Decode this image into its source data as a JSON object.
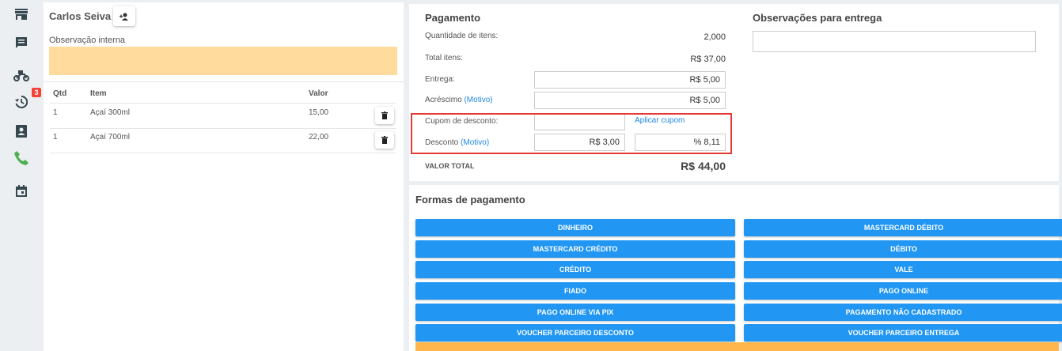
{
  "sidebar": {
    "icons": [
      "store-icon",
      "chat-icon",
      "delivery-moto-icon",
      "history-icon",
      "contact-card-icon",
      "phone-icon",
      "calendar-icon"
    ],
    "history_badge": "3",
    "phone_color": "#4caf50",
    "icon_color": "#37474f"
  },
  "order": {
    "customer_name": "Carlos Seiva",
    "internal_note_label": "Observação interna",
    "internal_note_value": "",
    "columns": {
      "qty": "Qtd",
      "item": "Item",
      "value": "Valor"
    },
    "items": [
      {
        "qty": "1",
        "name": "Açaí 300ml",
        "value": "15,00"
      },
      {
        "qty": "1",
        "name": "Açaí 700ml",
        "value": "22,00"
      }
    ]
  },
  "payment": {
    "title": "Pagamento",
    "quantity_label": "Quantidade de itens:",
    "quantity_value": "2,000",
    "total_items_label": "Total itens:",
    "total_items_value": "R$ 37,00",
    "delivery_label": "Entrega:",
    "delivery_value": "R$ 5,00",
    "surcharge_label": "Acréscimo",
    "motivo": "(Motivo)",
    "surcharge_value": "R$ 5,00",
    "coupon_label": "Cupom de desconto:",
    "coupon_value": "",
    "apply_coupon": "Aplicar cupom",
    "discount_label": "Desconto",
    "discount_value": "R$ 3,00",
    "discount_percent": "% 8,11",
    "grand_total_label": "VALOR TOTAL",
    "grand_total_value": "R$ 44,00"
  },
  "delivery_notes": {
    "title": "Observações para entrega",
    "value": ""
  },
  "payment_methods": {
    "title": "Formas de pagamento",
    "left": [
      "DINHEIRO",
      "MASTERCARD CRÉDITO",
      "CRÉDITO",
      "FIADO",
      "PAGO ONLINE VIA PIX",
      "VOUCHER PARCEIRO DESCONTO"
    ],
    "right": [
      "MASTERCARD DÉBITO",
      "DÉBITO",
      "VALE",
      "PAGO ONLINE",
      "PAGAMENTO NÃO CADASTRADO",
      "VOUCHER PARCEIRO ENTREGA"
    ],
    "button_color": "#2196f3",
    "footer_bar_color": "#ffb74d"
  },
  "highlight_color": "#e53935"
}
